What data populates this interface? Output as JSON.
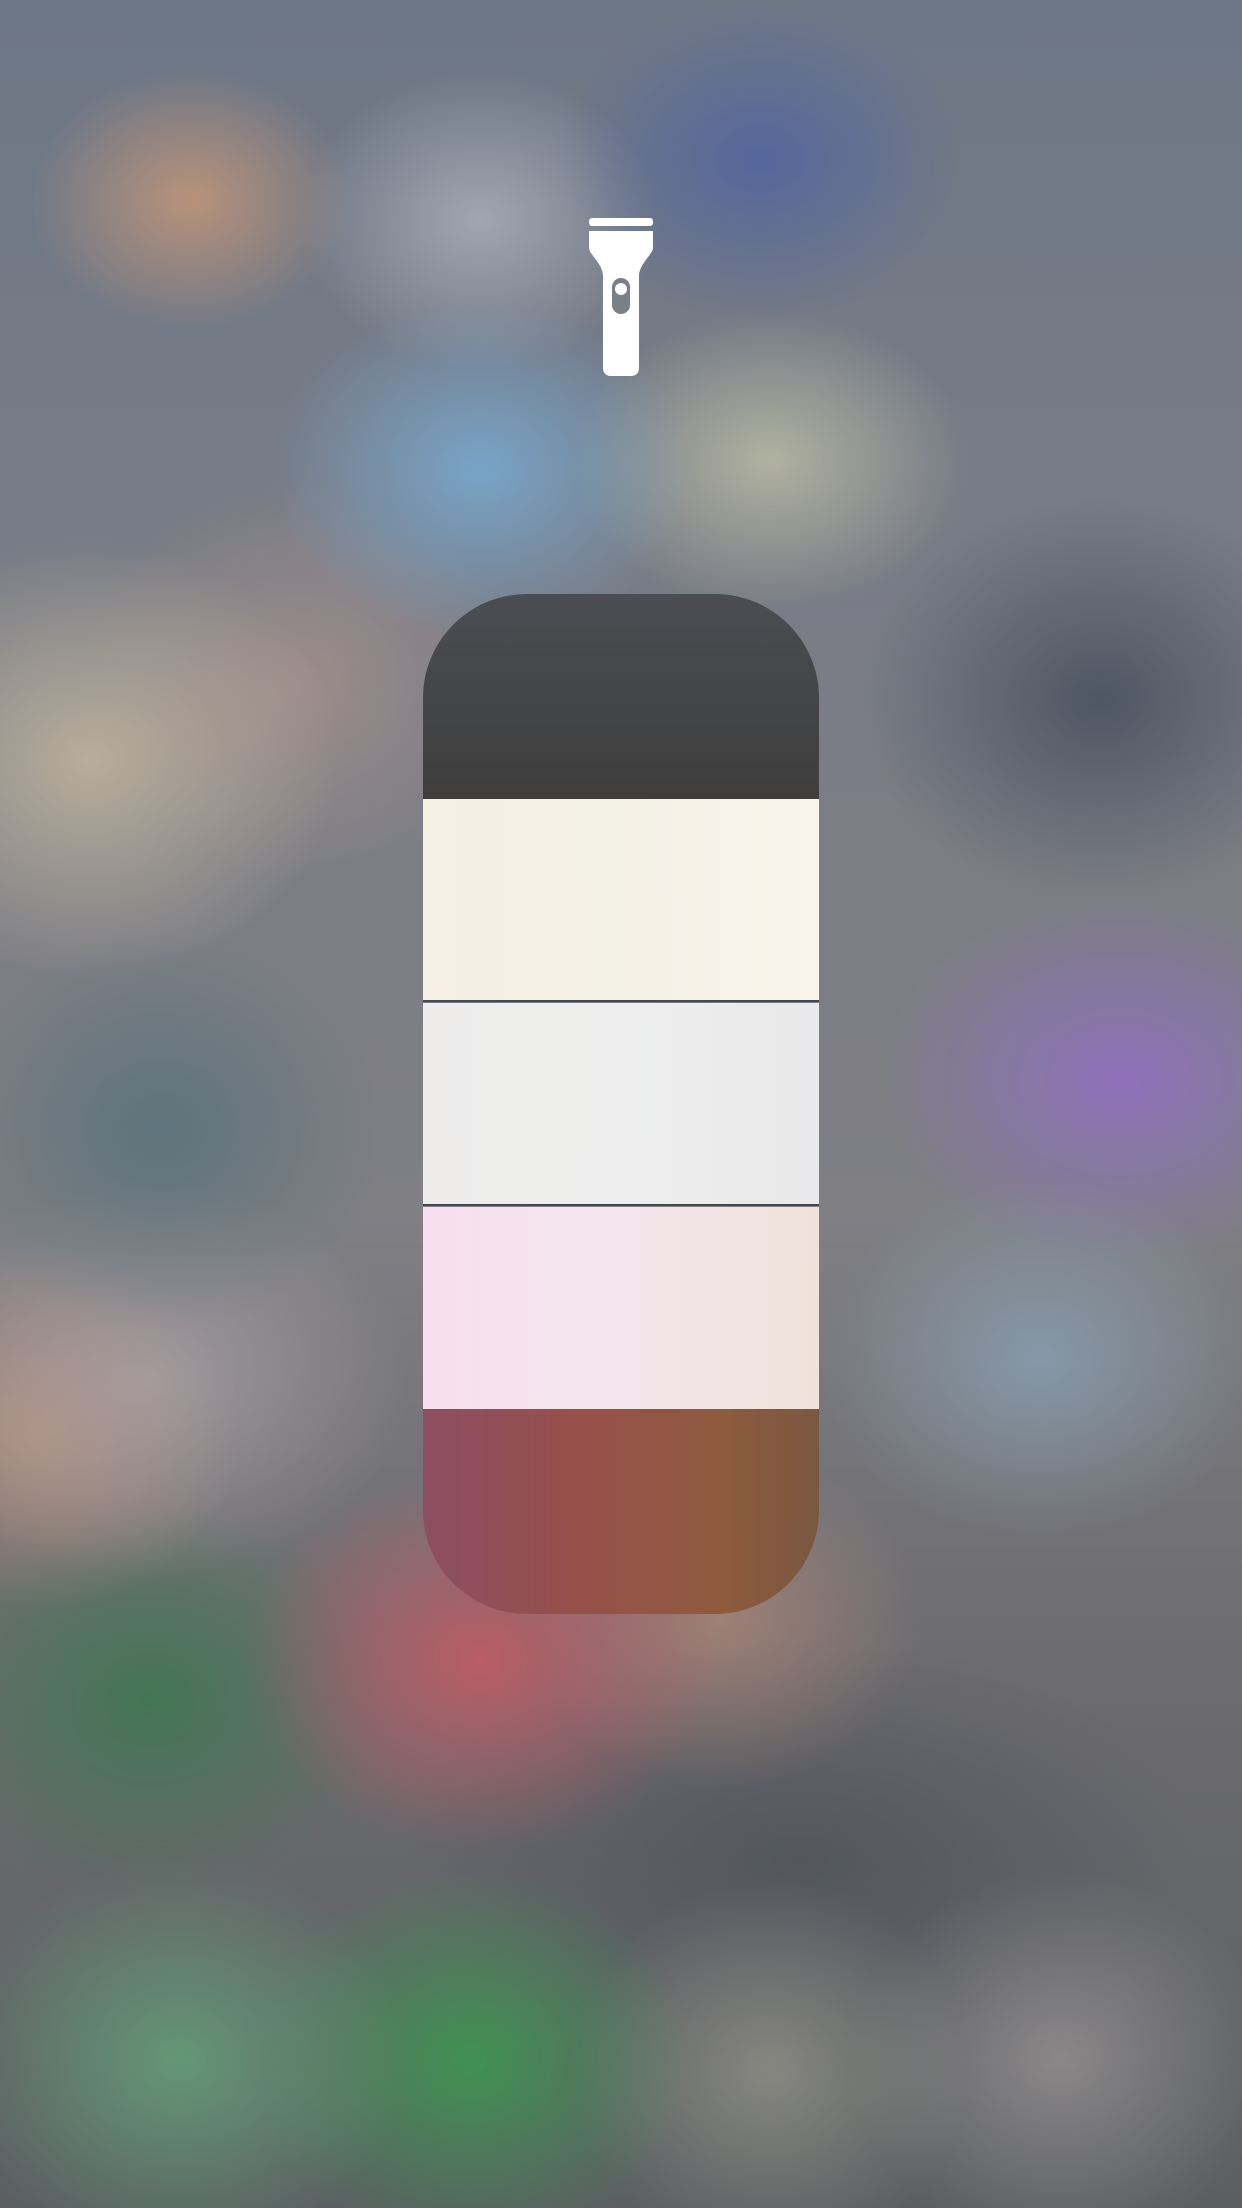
{
  "screen": {
    "name": "flashlight-brightness-control"
  },
  "flashlight": {
    "icon": "flashlight-icon",
    "color": "#ffffff"
  },
  "brightness_slider": {
    "levels_total": 4,
    "level_selected": 3,
    "fill_color": "#f2efe9",
    "track_color": "#3f3f40"
  }
}
